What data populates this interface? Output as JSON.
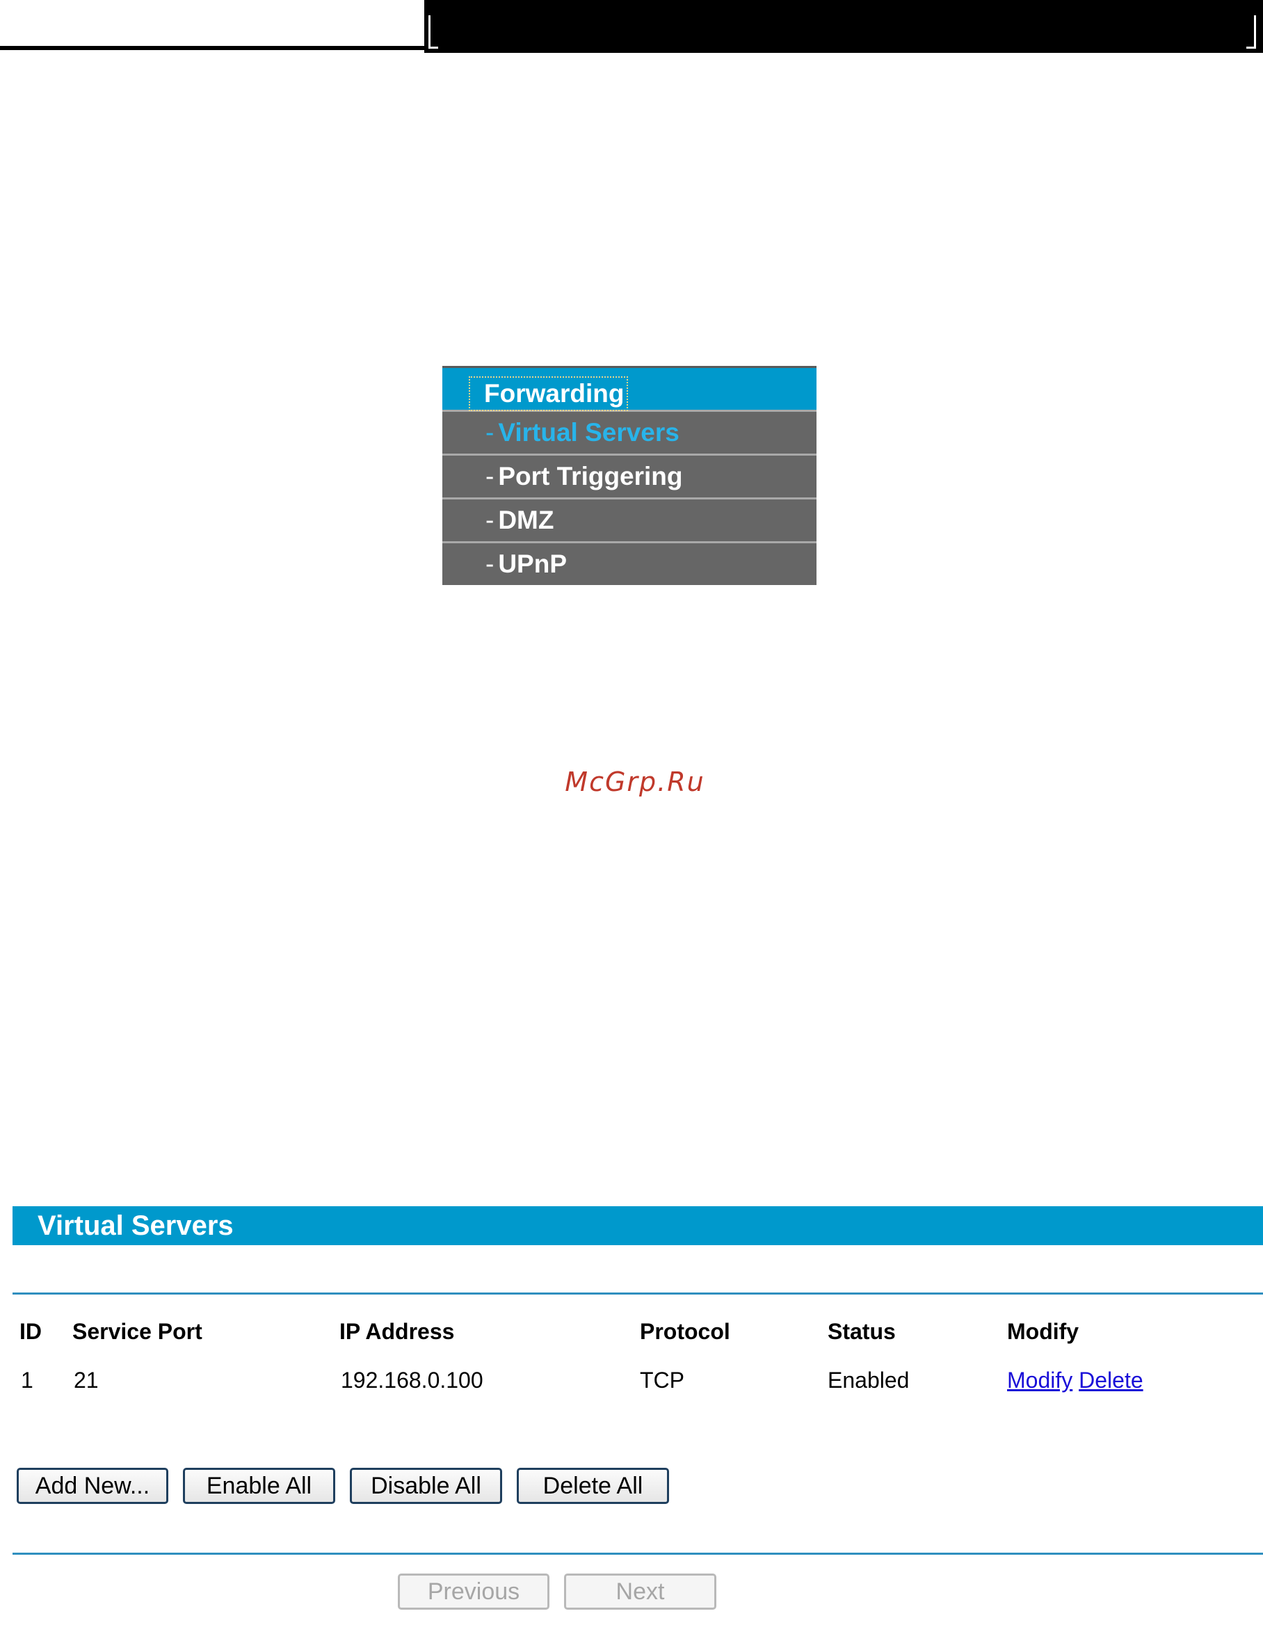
{
  "menu": {
    "header": "Forwarding",
    "items": [
      {
        "label": "Virtual Servers",
        "active": true
      },
      {
        "label": "Port Triggering",
        "active": false
      },
      {
        "label": "DMZ",
        "active": false
      },
      {
        "label": "UPnP",
        "active": false
      }
    ],
    "dash": "-"
  },
  "watermark": "McGrp.Ru",
  "panel": {
    "title": "Virtual Servers",
    "columns": [
      "ID",
      "Service Port",
      "IP Address",
      "Protocol",
      "Status",
      "Modify"
    ],
    "rows": [
      {
        "id": "1",
        "service_port": "21",
        "ip_address": "192.168.0.100",
        "protocol": "TCP",
        "status": "Enabled",
        "modify_link": "Modify",
        "delete_link": "Delete"
      }
    ],
    "buttons": {
      "add_new": "Add New...",
      "enable_all": "Enable All",
      "disable_all": "Disable All",
      "delete_all": "Delete All"
    },
    "pagination": {
      "previous": "Previous",
      "next": "Next"
    }
  },
  "colors": {
    "accent": "#0099cc",
    "menu_bg": "#666666",
    "menu_active": "#28b4ea",
    "link": "#1a0fd8",
    "watermark": "#c0392b"
  }
}
